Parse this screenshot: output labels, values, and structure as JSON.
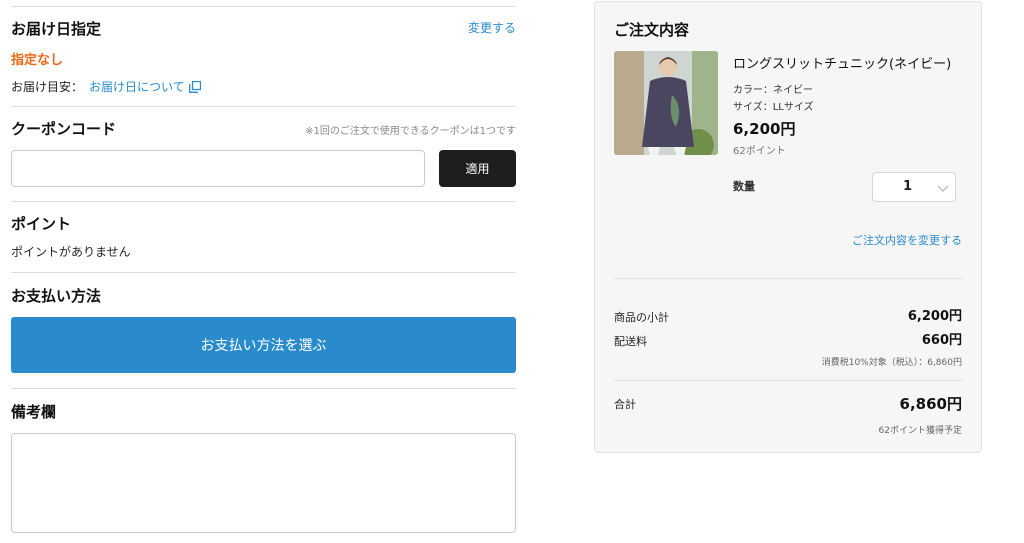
{
  "delivery": {
    "title": "お届け日指定",
    "change_link": "変更する",
    "status": "指定なし",
    "estimate_label": "お届け目安：",
    "about_link": "お届け日について",
    "status_color": "#ea6a1a"
  },
  "coupon": {
    "title": "クーポンコード",
    "note": "※1回のご注文で使用できるクーポンは1つです",
    "apply_label": "適用",
    "input_value": ""
  },
  "points": {
    "title": "ポイント",
    "message": "ポイントがありません"
  },
  "payment": {
    "title": "お支払い方法",
    "select_label": "お支払い方法を選ぶ"
  },
  "remarks": {
    "title": "備考欄",
    "value": ""
  },
  "order": {
    "title": "ご注文内容",
    "item": {
      "name": "ロングスリットチュニック(ネイビー)",
      "color": "カラー：ネイビー",
      "size": "サイズ：LLサイズ",
      "price": "6,200円",
      "points": "62ポイント",
      "qty_label": "数量",
      "qty_value": "1"
    },
    "change_link": "ご注文内容を変更する",
    "subtotal_label": "商品の小計",
    "subtotal_value": "6,200円",
    "shipping_label": "配送料",
    "shipping_value": "660円",
    "tax_note": "消費税10%対象（税込）：6,860円",
    "total_label": "合計",
    "total_value": "6,860円",
    "earn_points": "62ポイント獲得予定"
  },
  "colors": {
    "link": "#2a8bcc",
    "primary_button": "#2a8bcc",
    "dark_button": "#1e1e1e",
    "warning": "#ea6a1a"
  }
}
